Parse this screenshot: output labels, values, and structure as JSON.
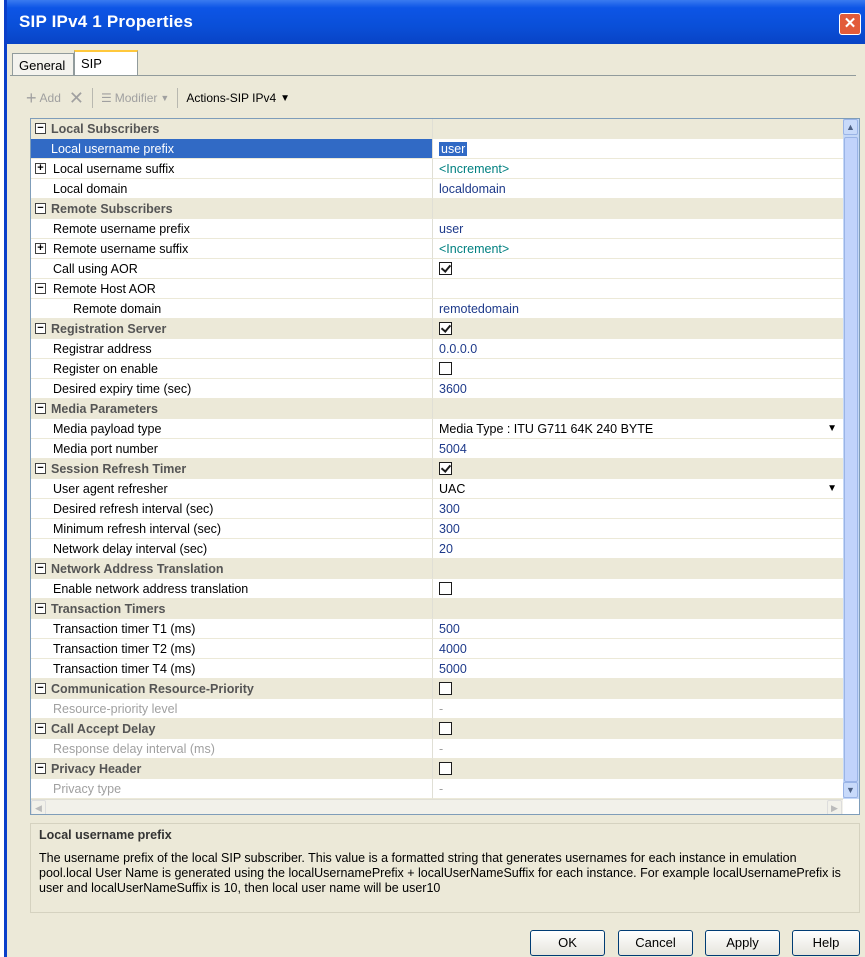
{
  "window": {
    "title": "SIP IPv4 1 Properties"
  },
  "tabs": [
    {
      "label": "General"
    },
    {
      "label": "SIP"
    }
  ],
  "toolbar": {
    "add": "Add",
    "modifier": "Modifier",
    "actions": "Actions-SIP IPv4"
  },
  "rows": [
    {
      "type": "category",
      "label": "Local Subscribers"
    },
    {
      "label": "Local username prefix",
      "value": "user",
      "selected": true
    },
    {
      "label": "Local username suffix",
      "value": "<Increment>",
      "expander": "+"
    },
    {
      "label": "Local domain",
      "value": "localdomain"
    },
    {
      "type": "category",
      "label": "Remote Subscribers"
    },
    {
      "label": "Remote username prefix",
      "value": "user"
    },
    {
      "label": "Remote username suffix",
      "value": "<Increment>",
      "expander": "+"
    },
    {
      "label": "Call using AOR",
      "checkbox": true
    },
    {
      "label": "Remote Host AOR",
      "expander": "-"
    },
    {
      "label": "Remote domain",
      "value": "remotedomain",
      "indent": 2
    },
    {
      "type": "category",
      "label": "Registration Server",
      "checkbox": true
    },
    {
      "label": "Registrar address",
      "value": "0.0.0.0"
    },
    {
      "label": "Register on enable",
      "checkbox": false
    },
    {
      "label": "Desired expiry time (sec)",
      "value": "3600"
    },
    {
      "type": "category",
      "label": "Media Parameters"
    },
    {
      "label": "Media payload type",
      "value": "Media Type : ITU G711 64K 240 BYTE",
      "dropdown": true
    },
    {
      "label": "Media port number",
      "value": "5004"
    },
    {
      "type": "category",
      "label": "Session Refresh Timer",
      "checkbox": true
    },
    {
      "label": "User agent refresher",
      "value": "UAC",
      "dropdown": true
    },
    {
      "label": "Desired refresh interval (sec)",
      "value": "300"
    },
    {
      "label": "Minimum refresh interval (sec)",
      "value": "300"
    },
    {
      "label": "Network delay interval (sec)",
      "value": "20"
    },
    {
      "type": "category",
      "label": "Network Address Translation"
    },
    {
      "label": "Enable network address translation",
      "checkbox": false
    },
    {
      "type": "category",
      "label": "Transaction Timers"
    },
    {
      "label": "Transaction timer T1 (ms)",
      "value": "500"
    },
    {
      "label": "Transaction timer T2 (ms)",
      "value": "4000"
    },
    {
      "label": "Transaction timer T4 (ms)",
      "value": "5000"
    },
    {
      "type": "category",
      "label": "Communication Resource-Priority",
      "checkbox": false
    },
    {
      "label": "Resource-priority level",
      "value": "-",
      "disabled": true
    },
    {
      "type": "category",
      "label": "Call Accept Delay",
      "checkbox": false
    },
    {
      "label": "Response delay interval (ms)",
      "value": "-",
      "disabled": true
    },
    {
      "type": "category",
      "label": "Privacy Header",
      "checkbox": false
    },
    {
      "label": "Privacy type",
      "value": "-",
      "disabled": true
    }
  ],
  "description": {
    "title": "Local username prefix",
    "body": "The username prefix of the local SIP subscriber. This value is a formatted string that generates usernames for each instance in emulation pool.local User Name is generated using the localUsernamePrefix + localUserNameSuffix for each instance. For example localUsernamePrefix is user and localUserNameSuffix is 10, then local user name will be user10"
  },
  "buttons": {
    "ok": "OK",
    "cancel": "Cancel",
    "apply": "Apply",
    "help": "Help"
  },
  "icons": {
    "close": "close-icon",
    "add": "plus-icon",
    "delete": "x-icon",
    "modifier": "modifier-icon",
    "collapse": "minus-box-icon",
    "expand": "plus-box-icon"
  },
  "colors": {
    "titlebar": "#0a4fd8",
    "selection": "#316ac5",
    "value_text": "#1e3a8a",
    "increment_text": "#008080"
  }
}
